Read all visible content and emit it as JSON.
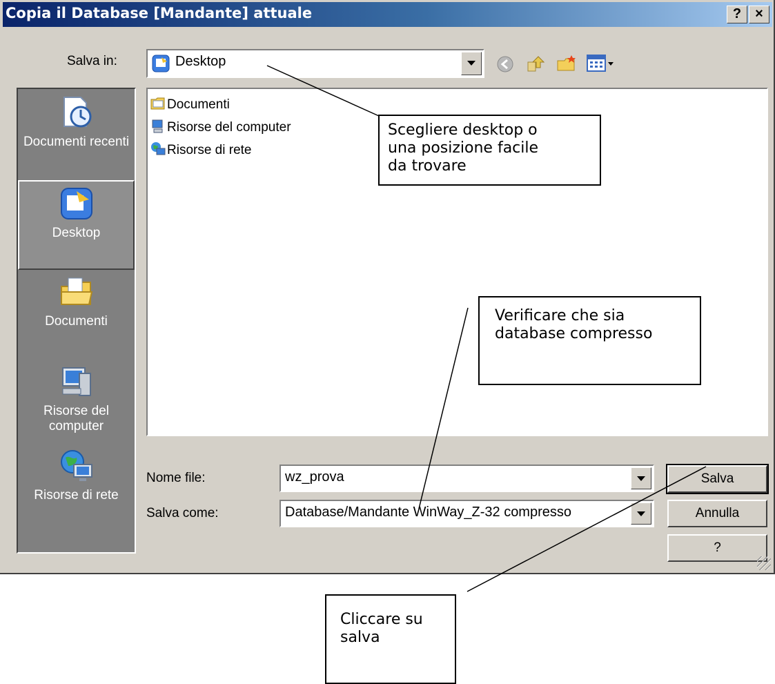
{
  "dialog": {
    "title": "Copia il Database [Mandante] attuale",
    "help_button": "?",
    "close_button": "×"
  },
  "save_in": {
    "label": "Salva in:",
    "value": "Desktop"
  },
  "places": [
    {
      "label": "Documenti recenti",
      "icon": "recent-documents-icon"
    },
    {
      "label": "Desktop",
      "icon": "desktop-icon",
      "selected": true
    },
    {
      "label": "Documenti",
      "icon": "my-documents-icon"
    },
    {
      "label": "Risorse del computer",
      "icon": "my-computer-icon"
    },
    {
      "label": "Risorse di rete",
      "icon": "network-places-icon"
    }
  ],
  "files": [
    {
      "name": "Documenti",
      "icon": "folder-icon"
    },
    {
      "name": "Risorse del computer",
      "icon": "computer-icon"
    },
    {
      "name": "Risorse di rete",
      "icon": "network-icon"
    }
  ],
  "filename": {
    "label": "Nome file:",
    "value": "wz_prova"
  },
  "save_as": {
    "label": "Salva come:",
    "value": "Database/Mandante WinWay_Z-32 compresso"
  },
  "buttons": {
    "save": "Salva",
    "cancel": "Annulla",
    "help": "?"
  },
  "callouts": {
    "choose_location": "Scegliere desktop o\nuna posizione facile\nda trovare",
    "verify_type": "Verificare che sia\ndatabase compresso",
    "click_save": "Cliccare su\nsalva"
  }
}
